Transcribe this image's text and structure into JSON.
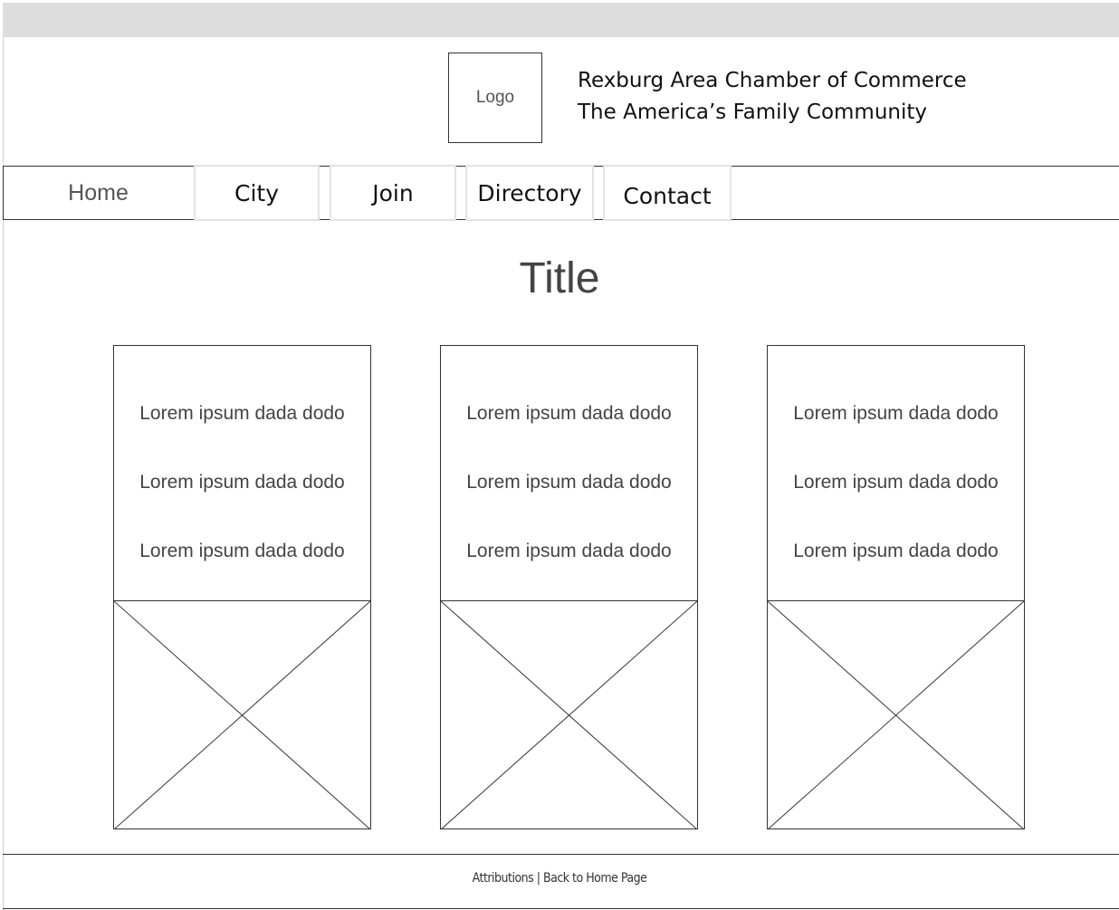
{
  "header": {
    "logo_label": "Logo",
    "org_name": "Rexburg Area Chamber of Commerce",
    "tagline": "The America’s Family Community"
  },
  "nav": {
    "home": "Home",
    "items": [
      {
        "label": "City"
      },
      {
        "label": "Join"
      },
      {
        "label": "Directory"
      },
      {
        "label": "Contact"
      }
    ]
  },
  "main": {
    "title": "Title",
    "cards": [
      {
        "lines": [
          "Lorem ipsum dada dodo",
          "Lorem ipsum dada dodo",
          "Lorem ipsum dada dodo"
        ]
      },
      {
        "lines": [
          "Lorem ipsum dada dodo",
          "Lorem ipsum dada dodo",
          "Lorem ipsum dada dodo"
        ]
      },
      {
        "lines": [
          "Lorem ipsum dada dodo",
          "Lorem ipsum dada dodo",
          "Lorem ipsum dada dodo"
        ]
      }
    ]
  },
  "footer": {
    "attributions": "Attributions",
    "separator": "|",
    "back_home": "Back to Home Page"
  }
}
